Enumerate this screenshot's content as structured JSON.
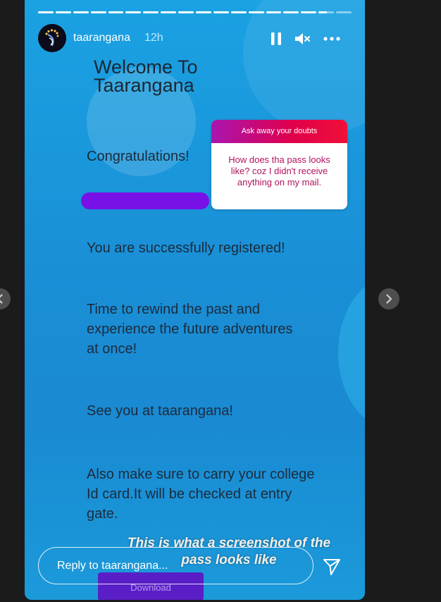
{
  "header": {
    "username": "taarangana",
    "time": "12h"
  },
  "icons": {
    "pause": "pause-icon",
    "mute": "muted-speaker-icon",
    "more": "more-horizontal-icon",
    "send": "paper-plane-icon",
    "prev": "chevron-left-icon",
    "next": "chevron-right-icon"
  },
  "progress": {
    "segments": 18,
    "current": 17,
    "current_fill": 0.55
  },
  "content": {
    "welcome": "Welcome To Taarangana",
    "congrats": "Congratulations!",
    "registered": "You are successfully registered!",
    "rewind": "Time to rewind the past and experience the future adventures at once!",
    "see_you": "See you at taarangana!",
    "id_card": "Also make sure to carry your college Id card.It will be checked at entry gate."
  },
  "question_box": {
    "title": "Ask away your doubts",
    "question": "How does tha pass looks like? coz I didn't receive anything on my mail."
  },
  "overlay_text": "This is what a screenshot of the pass looks like",
  "download_label": "Download",
  "reply": {
    "placeholder": "Reply to taarangana..."
  },
  "colors": {
    "background": "#1b1b1b",
    "scribble": "#7711e8",
    "question_text": "#b3125e"
  }
}
